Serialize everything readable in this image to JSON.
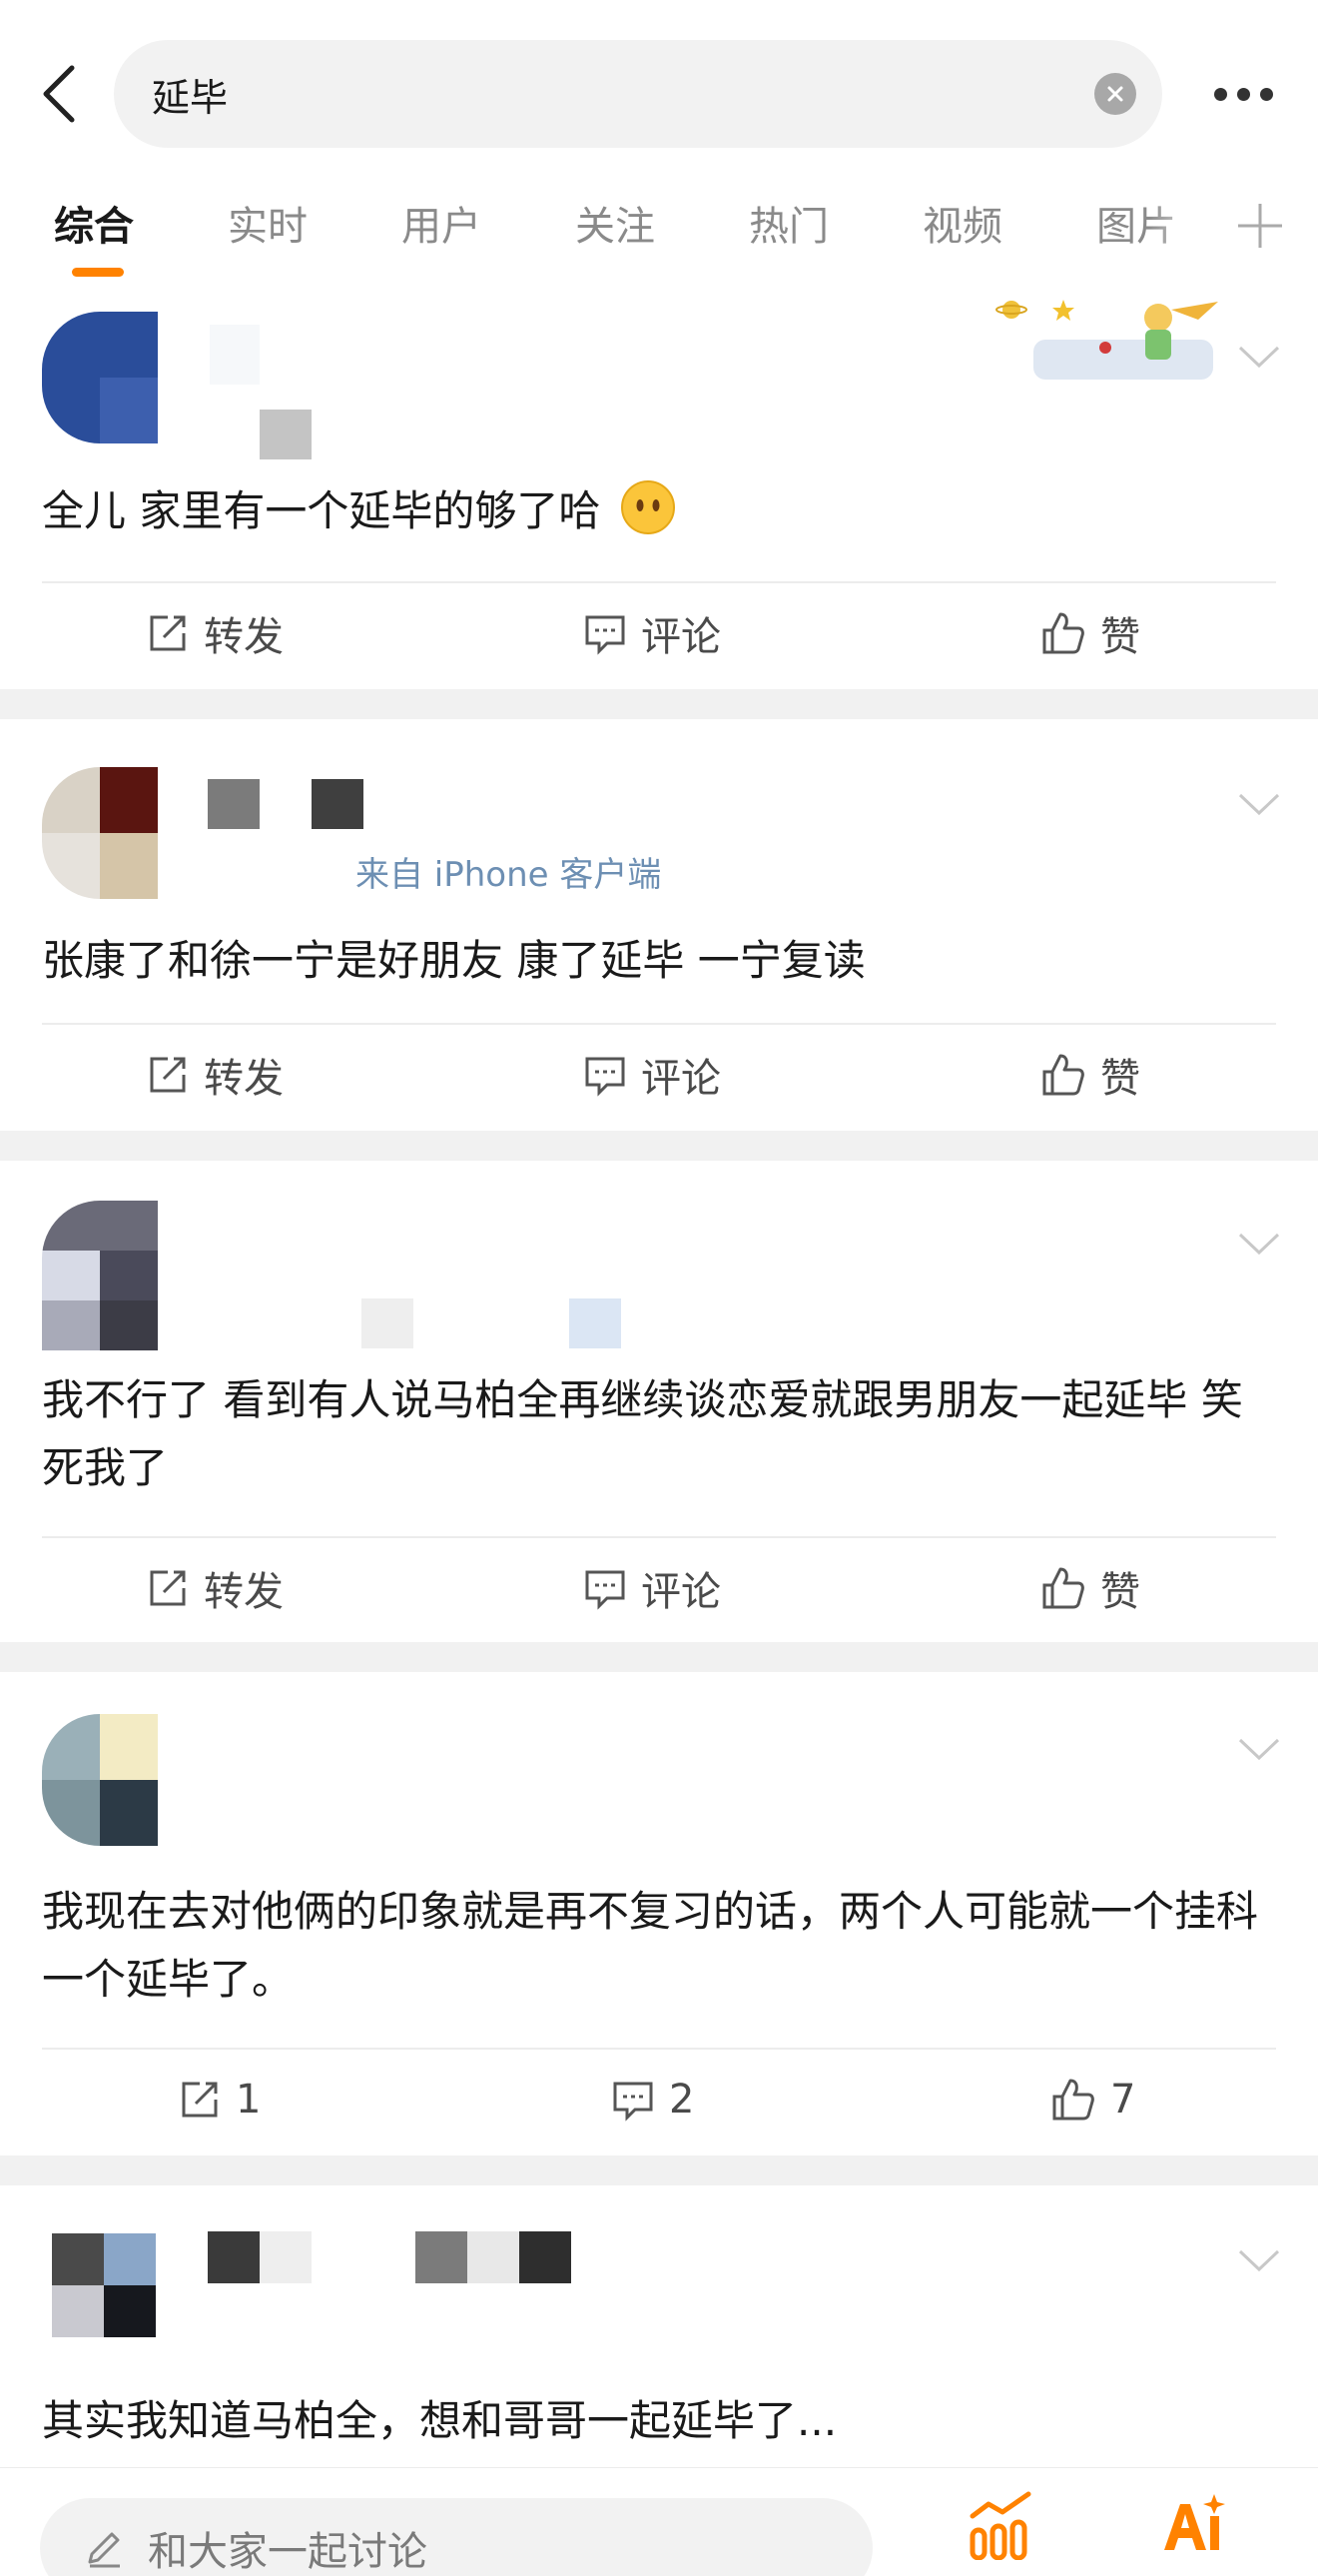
{
  "search": {
    "query": "延毕"
  },
  "tabs": [
    {
      "label": "综合"
    },
    {
      "label": "实时"
    },
    {
      "label": "用户"
    },
    {
      "label": "关注"
    },
    {
      "label": "热门"
    },
    {
      "label": "视频"
    },
    {
      "label": "图片"
    }
  ],
  "posts": [
    {
      "text": "全儿  家里有一个延毕的够了哈",
      "repost": "转发",
      "comment": "评论",
      "like": "赞"
    },
    {
      "source": "来自 iPhone 客户端",
      "text": "张康了和徐一宁是好朋友 康了延毕 一宁复读",
      "repost": "转发",
      "comment": "评论",
      "like": "赞"
    },
    {
      "text": "我不行了 看到有人说马柏全再继续谈恋爱就跟男朋友一起延毕 笑死我了",
      "repost": "转发",
      "comment": "评论",
      "like": "赞"
    },
    {
      "text": "我现在去对他俩的印象就是再不复习的话，两个人可能就一个挂科一个延毕了。",
      "repost": "1",
      "comment": "2",
      "like": "7"
    },
    {
      "text": "其实我知道马柏全，想和哥哥一起延毕了..."
    }
  ],
  "bottom": {
    "comment_placeholder": "和大家一起讨论"
  },
  "colors": {
    "accent": "#ff8200",
    "source_link": "#6d8fb3",
    "separator": "#f1f1f1"
  }
}
